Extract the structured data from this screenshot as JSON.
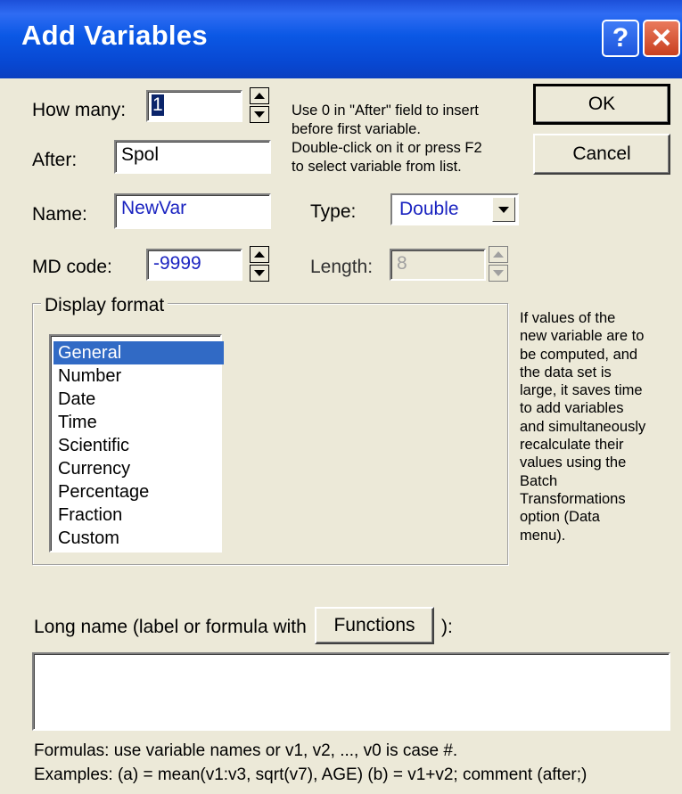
{
  "window": {
    "title": "Add Variables",
    "help_glyph": "?",
    "close_glyph": "✕"
  },
  "how_many": {
    "label": "How many:",
    "value": "1"
  },
  "after": {
    "label": "After:",
    "value": "Spol"
  },
  "name": {
    "label": "Name:",
    "value": "NewVar"
  },
  "type": {
    "label": "Type:",
    "value": "Double"
  },
  "md_code": {
    "label": "MD code:",
    "value": "-9999"
  },
  "length": {
    "label": "Length:",
    "value": "8"
  },
  "hint_lines": [
    "Use 0 in \"After\" field to insert",
    "before first variable.",
    "Double-click on it or press F2",
    "to select variable from list."
  ],
  "buttons": {
    "ok": "OK",
    "cancel": "Cancel",
    "functions": "Functions"
  },
  "display_format": {
    "title": "Display format",
    "selected": "General",
    "items": [
      "General",
      "Number",
      "Date",
      "Time",
      "Scientific",
      "Currency",
      "Percentage",
      "Fraction",
      "Custom"
    ]
  },
  "side_note_lines": [
    "If values of the",
    "new variable are to",
    "be computed, and",
    "the data set is",
    "large, it saves time",
    "to add variables",
    "and simultaneously",
    "recalculate their",
    "values using the",
    "Batch",
    "Transformations",
    "option (Data",
    "menu)."
  ],
  "long_name": {
    "label_before": "Long name (label or formula with",
    "label_after": "):",
    "value": ""
  },
  "footer": {
    "line1": "Formulas: use variable names or v1, v2, ..., v0 is case #.",
    "line2": "Examples:   (a) = mean(v1:v3, sqrt(v7), AGE)   (b) = v1+v2; comment (after;)"
  },
  "colors": {
    "title_bar": "#0a58e5",
    "dialog_bg": "#ece9d8",
    "selection": "#316ac5",
    "field_text_blue": "#1a23c0"
  }
}
